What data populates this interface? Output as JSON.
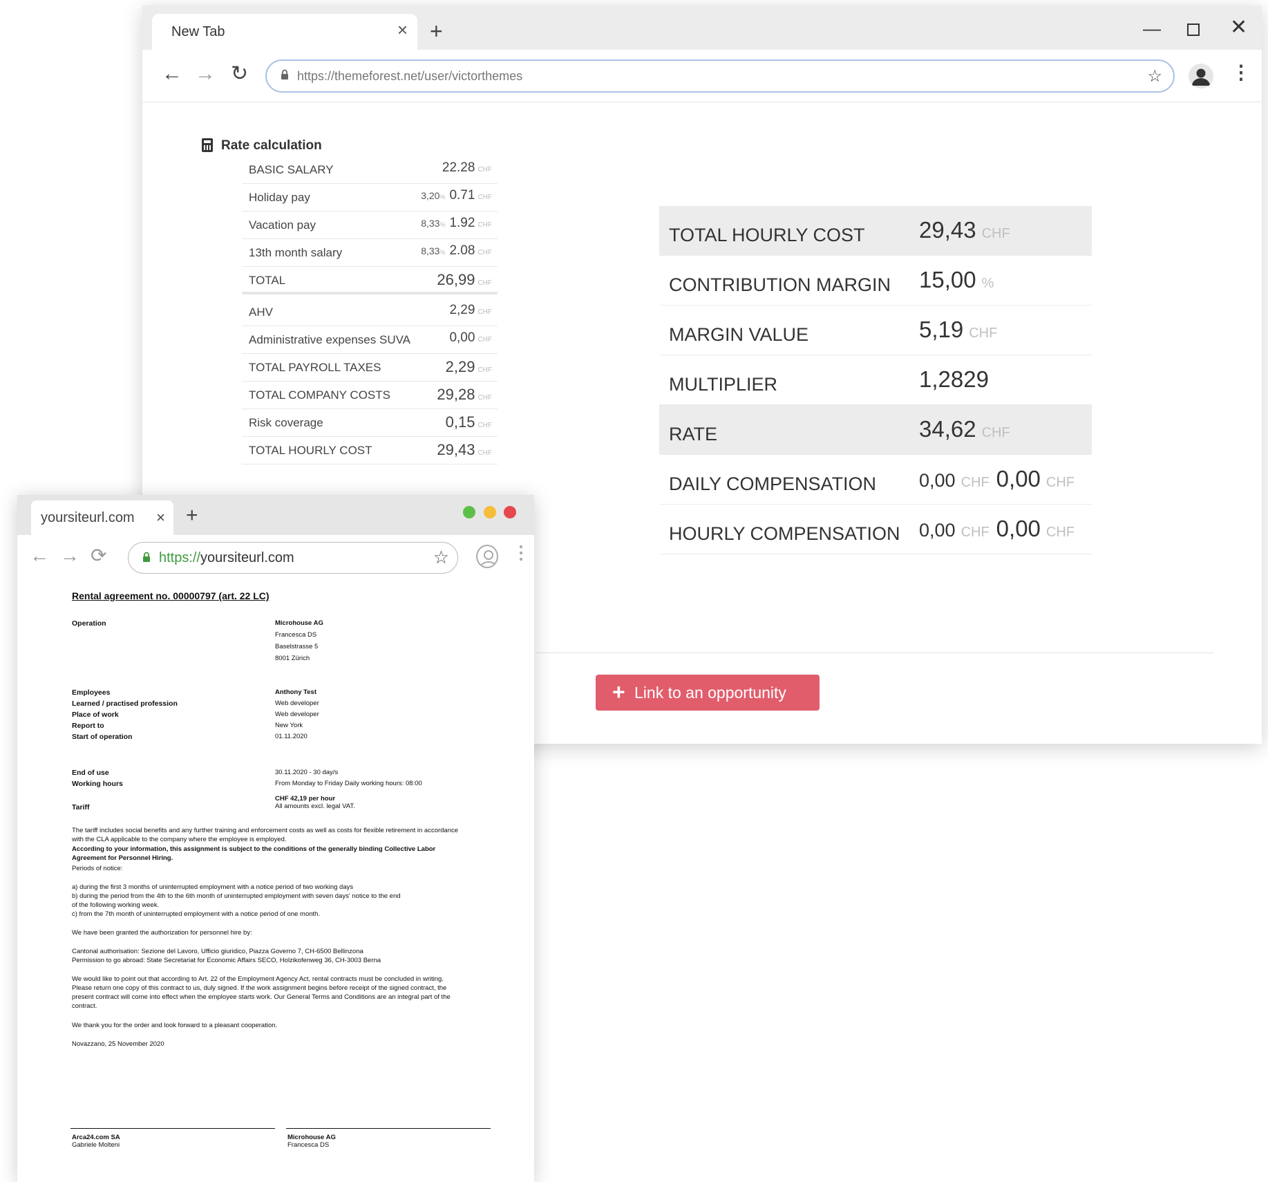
{
  "win1": {
    "tab_title": "New Tab",
    "url": "https://themeforest.net/user/victorthemes",
    "rate_calc": {
      "title": "Rate calculation",
      "rows": [
        {
          "label": "BASIC SALARY",
          "pct": "",
          "value": "22.28",
          "currency": "CHF"
        },
        {
          "label": "Holiday pay",
          "pct": "3,20",
          "value": "0.71",
          "currency": "CHF"
        },
        {
          "label": "Vacation pay",
          "pct": "8,33",
          "value": "1.92",
          "currency": "CHF"
        },
        {
          "label": "13th month salary",
          "pct": "8,33",
          "value": "2.08",
          "currency": "CHF"
        },
        {
          "label": "TOTAL",
          "pct": "",
          "value": "26,99",
          "currency": "CHF"
        },
        {
          "label": "AHV",
          "pct": "",
          "value": "2,29",
          "currency": "CHF"
        },
        {
          "label": "Administrative expenses SUVA",
          "pct": "",
          "value": "0,00",
          "currency": "CHF"
        },
        {
          "label": "TOTAL PAYROLL TAXES",
          "pct": "",
          "value": "2,29",
          "currency": "CHF"
        },
        {
          "label": "TOTAL COMPANY COSTS",
          "pct": "",
          "value": "29,28",
          "currency": "CHF"
        },
        {
          "label": "Risk coverage",
          "pct": "",
          "value": "0,15",
          "currency": "CHF"
        },
        {
          "label": "TOTAL HOURLY COST",
          "pct": "",
          "value": "29,43",
          "currency": "CHF"
        }
      ],
      "pct_symbol": "%"
    },
    "summary": [
      {
        "label": "TOTAL HOURLY COST",
        "value": "29,43",
        "unit": "CHF"
      },
      {
        "label": "CONTRIBUTION MARGIN",
        "value": "15,00",
        "unit": "%"
      },
      {
        "label": "MARGIN VALUE",
        "value": "5,19",
        "unit": "CHF"
      },
      {
        "label": "MULTIPLIER",
        "value": "1,2829",
        "unit": ""
      },
      {
        "label": "RATE",
        "value": "34,62",
        "unit": "CHF"
      },
      {
        "label": "DAILY COMPENSATION",
        "value_a": "0,00",
        "unit_a": "CHF",
        "value_b": "0,00",
        "unit_b": "CHF"
      },
      {
        "label": "HOURLY COMPENSATION",
        "value_a": "0,00",
        "unit_a": "CHF",
        "value_b": "0,00",
        "unit_b": "CHF"
      }
    ],
    "link_button": "Link to an opportunity"
  },
  "win2": {
    "tab_title": "yoursiteurl.com",
    "url_scheme": "https://",
    "url_host": "yoursiteurl.com",
    "doc": {
      "title": "Rental agreement no. 00000797 (art. 22 LC)",
      "operation_label": "Operation",
      "operation": [
        "Microhouse AG",
        "Francesca DS",
        "Baselstrasse 5",
        "8001 Zürich"
      ],
      "fields_1": [
        {
          "label": "Employees",
          "value": "Anthony Test"
        },
        {
          "label": "Learned / practised profession",
          "value": "Web developer"
        },
        {
          "label": "Place of work",
          "value": "Web developer"
        },
        {
          "label": "Report to",
          "value": "New York"
        },
        {
          "label": "Start of operation",
          "value": "01.11.2020"
        }
      ],
      "fields_2": [
        {
          "label": "End of use",
          "value": "30.11.2020 - 30 day/s"
        },
        {
          "label": "Working hours",
          "value": "From Monday to Friday Daily working hours: 08:00"
        }
      ],
      "tariff_label": "Tariff",
      "tariff_value": "CHF 42,19 per hour",
      "tariff_note": "All amounts excl. legal VAT.",
      "para_1": "The tariff includes social benefits and any further training and enforcement costs as well as costs for flexible retirement in accordance with the CLA applicable to the company where the employee is employed.",
      "para_2": "According to your information, this assignment is subject to the conditions of the generally binding Collective Labor Agreement for Personnel Hiring.",
      "para_3": "Periods of notice:",
      "notice": [
        "a) during the first 3 months of uninterrupted employment with a notice period of two working days",
        "b) during the period from the 4th to the 6th month of uninterrupted employment with seven days' notice to the end",
        "of the following working week.",
        "c) from the 7th month of uninterrupted employment with a notice period of one month."
      ],
      "para_4": "We have been granted the authorization for personnel hire by:",
      "auth": [
        "Cantonal authorisation: Sezione del Lavoro, Ufficio giuridico, Piazza Governo 7, CH-6500 Bellinzona",
        "Permission to go abroad: State Secretariat for Economic Affairs SECO, Holzikofenweg 36, CH-3003 Berna"
      ],
      "para_5": "We would like to point out that according to Art. 22 of the Employment Agency Act, rental contracts must be concluded in writing. Please return one copy of this contract to us, duly signed. If the work assignment begins before receipt of the signed contract, the present contract will come into effect when the employee starts work. Our General Terms and Conditions are an integral part of the contract.",
      "para_6": "We thank you for the order and look forward to a pleasant cooperation.",
      "place_date": "Novazzano, 25 November 2020",
      "sig_left": [
        "Arca24.com SA",
        "Gabriele Molteni"
      ],
      "sig_right": [
        "Microhouse AG",
        "Francesca DS"
      ]
    }
  },
  "colors": {
    "accent_button": "#e15d6c",
    "highlight_row": "#ececec",
    "traffic_green": "#5cbf4a",
    "traffic_yellow": "#f5bd3a",
    "traffic_red": "#e5484d"
  }
}
